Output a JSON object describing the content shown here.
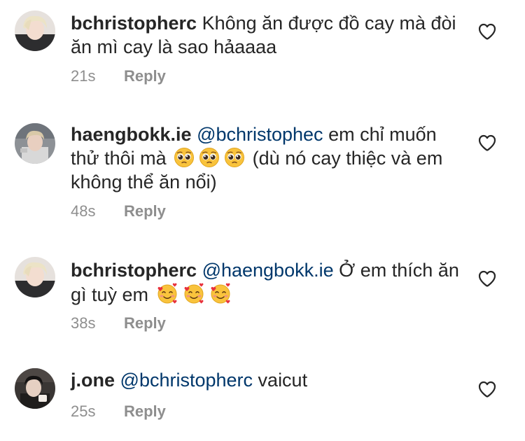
{
  "comments": [
    {
      "username": "bchristopherc",
      "text": "Không ăn được đồ cay mà đòi ăn mì cay là sao hảaaaa",
      "time": "21s",
      "reply_label": "Reply"
    },
    {
      "username": "haengbokk.ie",
      "mention": "@bchristophec",
      "text_before_emoji": "em chỉ muốn thử thôi mà",
      "text_after_emoji": "(dù nó cay thiệc và em không thể ăn nổi)",
      "emoji": [
        "pleading-face",
        "pleading-face",
        "pleading-face"
      ],
      "time": "48s",
      "reply_label": "Reply"
    },
    {
      "username": "bchristopherc",
      "mention": "@haengbokk.ie",
      "text_before_emoji": "Ở em thích ăn gì tuỳ em",
      "emoji": [
        "smiling-face-with-hearts",
        "smiling-face-with-hearts",
        "smiling-face-with-hearts"
      ],
      "time": "38s",
      "reply_label": "Reply"
    },
    {
      "username": "j.one",
      "mention": "@bchristopherc",
      "text": "vaicut",
      "time": "25s",
      "reply_label": "Reply"
    }
  ],
  "colors": {
    "text": "#262626",
    "mention": "#00376b",
    "meta": "#8e8e8e"
  }
}
